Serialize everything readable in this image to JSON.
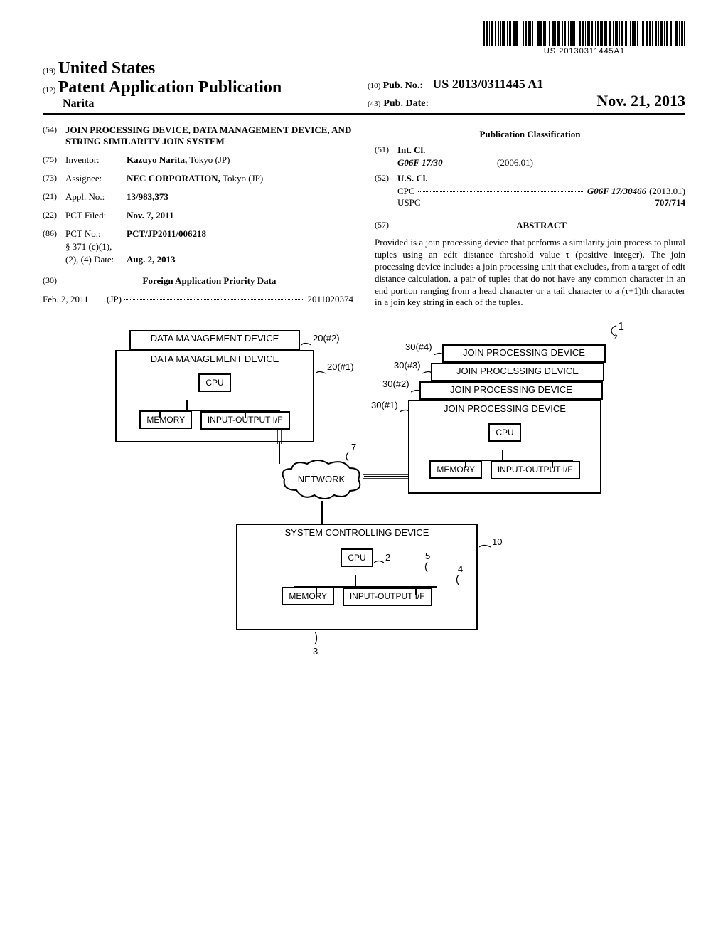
{
  "barcode_number": "US 20130311445A1",
  "header": {
    "prefix19": "(19)",
    "country": "United States",
    "prefix12": "(12)",
    "pub_type": "Patent Application Publication",
    "inventor_surname": "Narita",
    "prefix10": "(10)",
    "pub_no_label": "Pub. No.:",
    "pub_no_value": "US 2013/0311445 A1",
    "prefix43": "(43)",
    "pub_date_label": "Pub. Date:",
    "pub_date_value": "Nov. 21, 2013"
  },
  "left": {
    "n54": "(54)",
    "title": "JOIN PROCESSING DEVICE, DATA MANAGEMENT DEVICE, AND STRING SIMILARITY JOIN SYSTEM",
    "n75": "(75)",
    "inventor_label": "Inventor:",
    "inventor_value": "Kazuyo Narita,",
    "inventor_loc": "Tokyo (JP)",
    "n73": "(73)",
    "assignee_label": "Assignee:",
    "assignee_value": "NEC CORPORATION,",
    "assignee_loc": "Tokyo (JP)",
    "n21": "(21)",
    "appl_label": "Appl. No.:",
    "appl_value": "13/983,373",
    "n22": "(22)",
    "pct_filed_label": "PCT Filed:",
    "pct_filed_value": "Nov. 7, 2011",
    "n86": "(86)",
    "pct_no_label": "PCT No.:",
    "pct_no_value": "PCT/JP2011/006218",
    "s371_line": "§ 371 (c)(1),",
    "s371_date_label": "(2), (4) Date:",
    "s371_date_value": "Aug. 2, 2013",
    "n30": "(30)",
    "foreign_heading": "Foreign Application Priority Data",
    "foreign_date": "Feb. 2, 2011",
    "foreign_country": "(JP)",
    "foreign_number": "2011020374"
  },
  "right": {
    "pub_class_heading": "Publication Classification",
    "n51": "(51)",
    "int_cl_label": "Int. Cl.",
    "int_cl_code": "G06F 17/30",
    "int_cl_date": "(2006.01)",
    "n52": "(52)",
    "us_cl_label": "U.S. Cl.",
    "cpc_label": "CPC",
    "cpc_value": "G06F 17/30466",
    "cpc_date": "(2013.01)",
    "uspc_label": "USPC",
    "uspc_value": "707/714",
    "n57": "(57)",
    "abstract_heading": "ABSTRACT",
    "abstract_text": "Provided is a join processing device that performs a similarity join process to plural tuples using an edit distance threshold value τ (positive integer). The join processing device includes a join processing unit that excludes, from a target of edit distance calculation, a pair of tuples that do not have any common character in an end portion ranging from a head character or a tail character to a (τ+1)th character in a join key string in each of the tuples."
  },
  "diagram": {
    "ref_one": "1",
    "dmd": "DATA MANAGEMENT DEVICE",
    "jpd": "JOIN PROCESSING DEVICE",
    "cpu": "CPU",
    "memory": "MEMORY",
    "io": "INPUT-OUTPUT I/F",
    "network": "NETWORK",
    "scd": "SYSTEM CONTROLLING DEVICE",
    "l20_2": "20(#2)",
    "l20_1": "20(#1)",
    "l30_4": "30(#4)",
    "l30_3": "30(#3)",
    "l30_2": "30(#2)",
    "l30_1": "30(#1)",
    "l7": "7",
    "l10": "10",
    "l2": "2",
    "l3": "3",
    "l4": "4",
    "l5": "5"
  }
}
